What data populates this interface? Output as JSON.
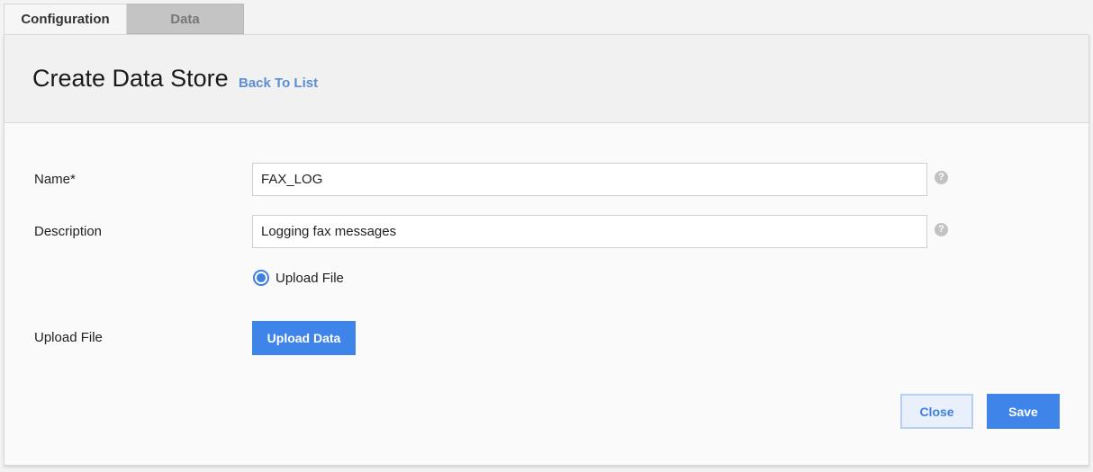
{
  "tabs": [
    {
      "label": "Configuration",
      "active": true
    },
    {
      "label": "Data",
      "active": false
    }
  ],
  "header": {
    "title": "Create Data Store",
    "back_link": "Back To List"
  },
  "form": {
    "name": {
      "label": "Name*",
      "value": "FAX_LOG",
      "help": "?"
    },
    "description": {
      "label": "Description",
      "value": "Logging fax messages",
      "help": "?"
    },
    "source_option": {
      "label": "Upload File",
      "selected": true
    },
    "upload": {
      "label": "Upload File",
      "button": "Upload Data"
    }
  },
  "footer": {
    "close_label": "Close",
    "save_label": "Save"
  },
  "colors": {
    "accent": "#3f84e8",
    "link": "#5b8ed6",
    "help_icon": "#c2c2c2"
  }
}
